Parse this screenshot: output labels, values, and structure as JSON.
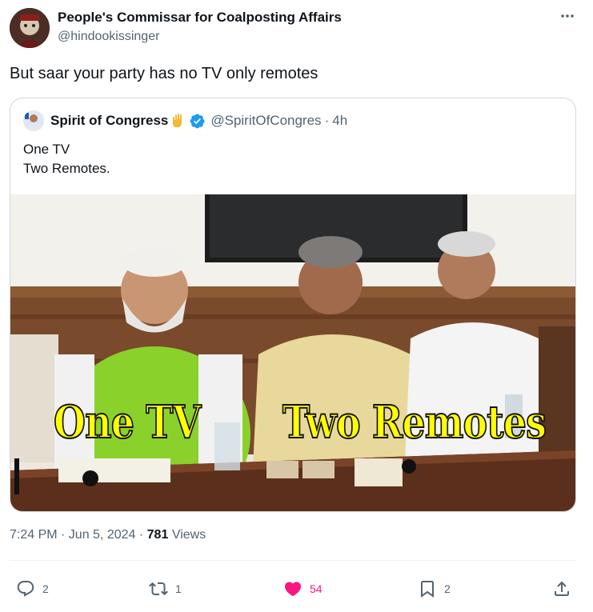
{
  "tweet": {
    "author": {
      "display_name": "People's Commissar for Coalposting Affairs",
      "handle": "@hindookissinger"
    },
    "text": "But saar your party has no TV only remotes",
    "timestamp": "7:24 PM · Jun 5, 2024",
    "views_sep": " · ",
    "views_count": "781",
    "views_label": "Views",
    "more_icon": "more-horizontal-icon"
  },
  "quote": {
    "display_name": "Spirit of Congress",
    "hand_icon": "raised-hand-emoji",
    "verified_icon": "verified-badge-icon",
    "handle": "@SpiritOfCongres",
    "separator": "·",
    "time": "4h",
    "text_lines": [
      "One TV",
      "Two Remotes."
    ],
    "media": {
      "caption_left": "One TV",
      "caption_right": "Two Remotes",
      "caption_color": "#ffff00"
    }
  },
  "actions": {
    "reply": {
      "icon": "reply-icon",
      "count": "2"
    },
    "retweet": {
      "icon": "retweet-icon",
      "count": "1"
    },
    "like": {
      "icon": "heart-icon",
      "count": "54",
      "color": "#f91880",
      "liked": true
    },
    "bookmark": {
      "icon": "bookmark-icon",
      "count": "2"
    },
    "share": {
      "icon": "share-icon"
    }
  },
  "colors": {
    "text_primary": "#0f1419",
    "text_secondary": "#536471",
    "border": "#cfd9de",
    "verified": "#1d9bf0",
    "like": "#f91880"
  }
}
